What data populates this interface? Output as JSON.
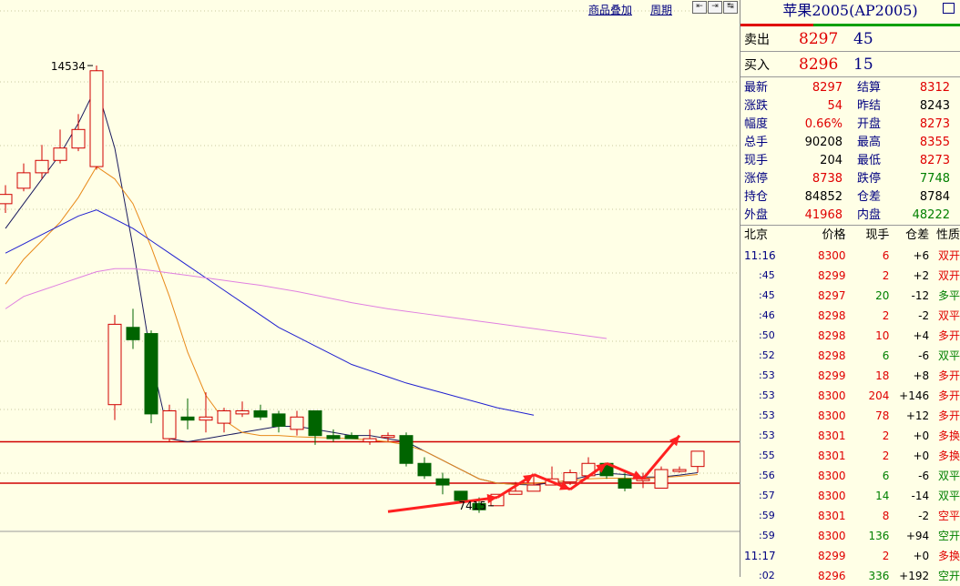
{
  "toolbar": {
    "overlay_label": "商品叠加",
    "period_label": "周期",
    "nav_buttons": [
      "⇤",
      "⇥",
      "↹"
    ]
  },
  "chart_data": {
    "type": "candlestick",
    "y_marker_high": "14534",
    "y_marker_low": "7415",
    "ylim": [
      7000,
      15300
    ],
    "support_lines": [
      8450,
      7780
    ],
    "candles": [
      [
        12300,
        12600,
        12150,
        12450
      ],
      [
        12550,
        12950,
        12500,
        12800
      ],
      [
        12800,
        13250,
        12700,
        13000
      ],
      [
        13000,
        13500,
        12950,
        13200
      ],
      [
        13200,
        13750,
        13150,
        13500
      ],
      [
        12900,
        14534,
        12850,
        14450
      ],
      [
        9050,
        10500,
        8800,
        10350
      ],
      [
        10300,
        10600,
        9950,
        10100
      ],
      [
        10200,
        10250,
        8750,
        8900
      ],
      [
        8500,
        9050,
        8450,
        8950
      ],
      [
        8850,
        9150,
        8650,
        8800
      ],
      [
        8800,
        9250,
        8600,
        8850
      ],
      [
        8750,
        9000,
        8600,
        8950
      ],
      [
        8900,
        9100,
        8850,
        8950
      ],
      [
        8950,
        9050,
        8800,
        8850
      ],
      [
        8900,
        8950,
        8600,
        8700
      ],
      [
        8650,
        8950,
        8550,
        8850
      ],
      [
        8950,
        8950,
        8400,
        8550
      ],
      [
        8550,
        8650,
        8450,
        8500
      ],
      [
        8550,
        8600,
        8500,
        8500
      ],
      [
        8450,
        8650,
        8400,
        8500
      ],
      [
        8550,
        8600,
        8450,
        8550
      ],
      [
        8550,
        8600,
        8050,
        8100
      ],
      [
        8100,
        8200,
        7850,
        7900
      ],
      [
        7850,
        7950,
        7600,
        7750
      ],
      [
        7650,
        7650,
        7450,
        7500
      ],
      [
        7450,
        7550,
        7300,
        7350
      ],
      [
        7415,
        7600,
        7415,
        7600
      ],
      [
        7600,
        7800,
        7600,
        7650
      ],
      [
        7650,
        7900,
        7650,
        7750
      ],
      [
        7750,
        8050,
        7750,
        7850
      ],
      [
        7800,
        8000,
        7750,
        7950
      ],
      [
        7900,
        8200,
        7850,
        8100
      ],
      [
        8100,
        8100,
        7850,
        7900
      ],
      [
        7850,
        7950,
        7650,
        7700
      ],
      [
        7850,
        7950,
        7700,
        7850
      ],
      [
        7700,
        8050,
        7700,
        8000
      ],
      [
        8000,
        8050,
        7950,
        8000
      ],
      [
        8050,
        8300,
        7950,
        8297
      ]
    ],
    "ma_series": [
      {
        "color": "#1a1a5e",
        "values": [
          11900,
          12300,
          12700,
          13100,
          13600,
          14200,
          13200,
          11600,
          9800,
          8500,
          8450,
          8500,
          8550,
          8600,
          8650,
          8700,
          8700,
          8650,
          8600,
          8550,
          8550,
          8500,
          8450,
          8300,
          8150,
          8000,
          7850,
          7780,
          7760,
          7750,
          7790,
          7830,
          7900,
          7940,
          7920,
          7880,
          7880,
          7910,
          7950
        ]
      },
      {
        "color": "#e88a1a",
        "values": [
          11000,
          11400,
          11700,
          12000,
          12400,
          12900,
          12700,
          12300,
          11600,
          10800,
          9900,
          9200,
          8800,
          8600,
          8550,
          8550,
          8530,
          8520,
          8510,
          8500,
          8480,
          8450,
          8400,
          8300,
          8150,
          8000,
          7850,
          7780,
          7760,
          7780,
          7800,
          7820,
          7850,
          7860,
          7860,
          7860,
          7870,
          7890,
          7920
        ]
      },
      {
        "color": "#2020d0",
        "values": [
          11500,
          11650,
          11800,
          11950,
          12100,
          12200,
          12050,
          11900,
          11700,
          11500,
          11300,
          11100,
          10900,
          10700,
          10500,
          10300,
          10150,
          10000,
          9850,
          9700,
          9600,
          9500,
          9400,
          9320,
          9240,
          9160,
          9080,
          9000,
          8940,
          8880
        ]
      },
      {
        "color": "#e080e0",
        "values": [
          10600,
          10800,
          10900,
          11000,
          11100,
          11200,
          11250,
          11250,
          11220,
          11180,
          11140,
          11100,
          11060,
          11020,
          10980,
          10930,
          10880,
          10820,
          10760,
          10700,
          10650,
          10600,
          10560,
          10520,
          10480,
          10440,
          10400,
          10360,
          10320,
          10280,
          10240,
          10200,
          10160,
          10120
        ]
      }
    ],
    "arrows": [
      [
        21,
        7320,
        27,
        7550
      ],
      [
        27,
        7550,
        29,
        7920
      ],
      [
        29,
        7920,
        31,
        7680
      ],
      [
        31,
        7680,
        33,
        8100
      ],
      [
        33,
        8100,
        35,
        7850
      ],
      [
        35,
        7850,
        37,
        8550
      ]
    ]
  },
  "panel": {
    "title": "苹果2005(AP2005)",
    "sell": {
      "label": "卖出",
      "price": "8297",
      "volume": "45"
    },
    "buy": {
      "label": "买入",
      "price": "8296",
      "volume": "15"
    },
    "stats": [
      {
        "l1": "最新",
        "v1": "8297",
        "c1": "red",
        "l2": "结算",
        "v2": "8312",
        "c2": "red"
      },
      {
        "l1": "涨跌",
        "v1": "54",
        "c1": "red",
        "l2": "昨结",
        "v2": "8243",
        "c2": "dark"
      },
      {
        "l1": "幅度",
        "v1": "0.66%",
        "c1": "red",
        "l2": "开盘",
        "v2": "8273",
        "c2": "red"
      },
      {
        "l1": "总手",
        "v1": "90208",
        "c1": "dark",
        "l2": "最高",
        "v2": "8355",
        "c2": "red"
      },
      {
        "l1": "现手",
        "v1": "204",
        "c1": "dark",
        "l2": "最低",
        "v2": "8273",
        "c2": "red"
      },
      {
        "l1": "涨停",
        "v1": "8738",
        "c1": "red",
        "l2": "跌停",
        "v2": "7748",
        "c2": "green"
      },
      {
        "l1": "持仓",
        "v1": "84852",
        "c1": "dark",
        "l2": "仓差",
        "v2": "8784",
        "c2": "dark"
      },
      {
        "l1": "外盘",
        "v1": "41968",
        "c1": "red",
        "l2": "内盘",
        "v2": "48222",
        "c2": "green"
      }
    ],
    "tick_header": {
      "time": "北京",
      "price": "价格",
      "vol": "现手",
      "oi": "仓差",
      "nature": "性质"
    },
    "ticks": [
      {
        "time": "11:16",
        "price": "8300",
        "vol": "6",
        "oi": "+6",
        "nature": "双开",
        "vc": "red",
        "nc": "red"
      },
      {
        "time": ":45",
        "price": "8299",
        "vol": "2",
        "oi": "+2",
        "nature": "双开",
        "vc": "red",
        "nc": "red"
      },
      {
        "time": ":45",
        "price": "8297",
        "vol": "20",
        "oi": "-12",
        "nature": "多平",
        "vc": "green",
        "nc": "green"
      },
      {
        "time": ":46",
        "price": "8298",
        "vol": "2",
        "oi": "-2",
        "nature": "双平",
        "vc": "red",
        "nc": "red"
      },
      {
        "time": ":50",
        "price": "8298",
        "vol": "10",
        "oi": "+4",
        "nature": "多开",
        "vc": "red",
        "nc": "red"
      },
      {
        "time": ":52",
        "price": "8298",
        "vol": "6",
        "oi": "-6",
        "nature": "双平",
        "vc": "green",
        "nc": "green"
      },
      {
        "time": ":53",
        "price": "8299",
        "vol": "18",
        "oi": "+8",
        "nature": "多开",
        "vc": "red",
        "nc": "red"
      },
      {
        "time": ":53",
        "price": "8300",
        "vol": "204",
        "oi": "+146",
        "nature": "多开",
        "vc": "red",
        "nc": "red"
      },
      {
        "time": ":53",
        "price": "8300",
        "vol": "78",
        "oi": "+12",
        "nature": "多开",
        "vc": "red",
        "nc": "red"
      },
      {
        "time": ":53",
        "price": "8301",
        "vol": "2",
        "oi": "+0",
        "nature": "多换",
        "vc": "red",
        "nc": "red"
      },
      {
        "time": ":55",
        "price": "8301",
        "vol": "2",
        "oi": "+0",
        "nature": "多换",
        "vc": "red",
        "nc": "red"
      },
      {
        "time": ":56",
        "price": "8300",
        "vol": "6",
        "oi": "-6",
        "nature": "双平",
        "vc": "green",
        "nc": "green"
      },
      {
        "time": ":57",
        "price": "8300",
        "vol": "14",
        "oi": "-14",
        "nature": "双平",
        "vc": "green",
        "nc": "green"
      },
      {
        "time": ":59",
        "price": "8301",
        "vol": "8",
        "oi": "-2",
        "nature": "空平",
        "vc": "red",
        "nc": "red"
      },
      {
        "time": ":59",
        "price": "8300",
        "vol": "136",
        "oi": "+94",
        "nature": "空开",
        "vc": "green",
        "nc": "green"
      },
      {
        "time": "11:17",
        "price": "8299",
        "vol": "2",
        "oi": "+0",
        "nature": "多换",
        "vc": "red",
        "nc": "red"
      },
      {
        "time": ":02",
        "price": "8296",
        "vol": "336",
        "oi": "+192",
        "nature": "空开",
        "vc": "green",
        "nc": "green"
      }
    ]
  }
}
